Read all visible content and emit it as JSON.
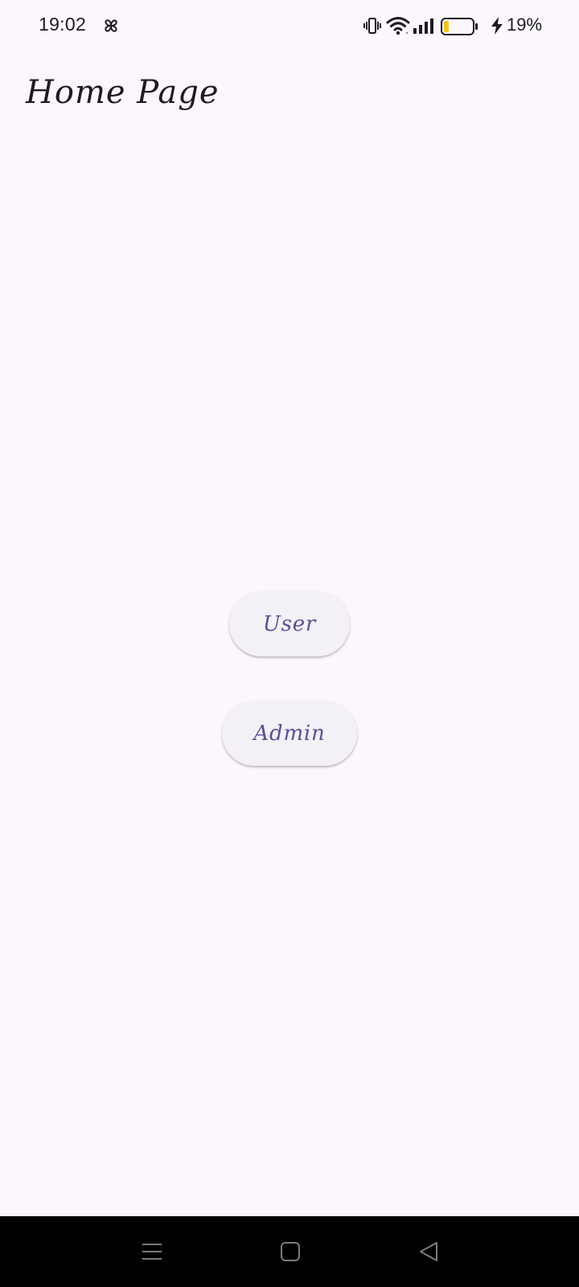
{
  "status_bar": {
    "time": "19:02",
    "battery_percent": "19%",
    "battery_level": 0.19,
    "icons": [
      "pinwheel-icon",
      "vibrate-icon",
      "wifi-icon",
      "signal-icon",
      "battery-icon",
      "charging-bolt-icon"
    ]
  },
  "page": {
    "title": "Home Page"
  },
  "buttons": {
    "user_label": "User",
    "admin_label": "Admin"
  },
  "nav_bar": {
    "icons": [
      "menu-icon",
      "home-icon",
      "back-icon"
    ]
  },
  "colors": {
    "background": "#fcf7fd",
    "button_background": "#f4f0f7",
    "button_text": "#5a4f9a",
    "battery_fill": "#f5c518"
  }
}
